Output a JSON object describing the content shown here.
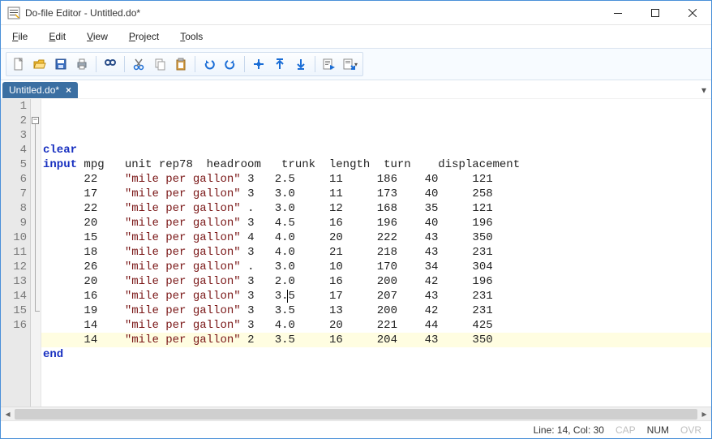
{
  "window": {
    "title": "Do-file Editor - Untitled.do*"
  },
  "menubar": {
    "file": {
      "ul": "F",
      "rest": "ile"
    },
    "edit": {
      "ul": "E",
      "rest": "dit"
    },
    "view": {
      "ul": "V",
      "rest": "iew"
    },
    "project": {
      "ul": "P",
      "rest": "roject"
    },
    "tools": {
      "ul": "T",
      "rest": "ools"
    }
  },
  "tab": {
    "label": "Untitled.do*",
    "close": "×"
  },
  "code": {
    "kw_clear": "clear",
    "kw_input": "input",
    "kw_end": "end",
    "header_vars": " mpg   unit rep78  headroom   trunk  length  turn    displacement",
    "rows": [
      {
        "mpg": "22",
        "unit": "\"mile per gallon\"",
        "rep78": "3",
        "headroom": "2.5",
        "trunk": "11",
        "length": "186",
        "turn": "40",
        "disp": "121"
      },
      {
        "mpg": "17",
        "unit": "\"mile per gallon\"",
        "rep78": "3",
        "headroom": "3.0",
        "trunk": "11",
        "length": "173",
        "turn": "40",
        "disp": "258"
      },
      {
        "mpg": "22",
        "unit": "\"mile per gallon\"",
        "rep78": ".",
        "headroom": "3.0",
        "trunk": "12",
        "length": "168",
        "turn": "35",
        "disp": "121"
      },
      {
        "mpg": "20",
        "unit": "\"mile per gallon\"",
        "rep78": "3",
        "headroom": "4.5",
        "trunk": "16",
        "length": "196",
        "turn": "40",
        "disp": "196"
      },
      {
        "mpg": "15",
        "unit": "\"mile per gallon\"",
        "rep78": "4",
        "headroom": "4.0",
        "trunk": "20",
        "length": "222",
        "turn": "43",
        "disp": "350"
      },
      {
        "mpg": "18",
        "unit": "\"mile per gallon\"",
        "rep78": "3",
        "headroom": "4.0",
        "trunk": "21",
        "length": "218",
        "turn": "43",
        "disp": "231"
      },
      {
        "mpg": "26",
        "unit": "\"mile per gallon\"",
        "rep78": ".",
        "headroom": "3.0",
        "trunk": "10",
        "length": "170",
        "turn": "34",
        "disp": "304"
      },
      {
        "mpg": "20",
        "unit": "\"mile per gallon\"",
        "rep78": "3",
        "headroom": "2.0",
        "trunk": "16",
        "length": "200",
        "turn": "42",
        "disp": "196"
      },
      {
        "mpg": "16",
        "unit": "\"mile per gallon\"",
        "rep78": "3",
        "headroom": "3.5",
        "trunk": "17",
        "length": "207",
        "turn": "43",
        "disp": "231"
      },
      {
        "mpg": "19",
        "unit": "\"mile per gallon\"",
        "rep78": "3",
        "headroom": "3.5",
        "trunk": "13",
        "length": "200",
        "turn": "42",
        "disp": "231"
      },
      {
        "mpg": "14",
        "unit": "\"mile per gallon\"",
        "rep78": "3",
        "headroom": "4.0",
        "trunk": "20",
        "length": "221",
        "turn": "44",
        "disp": "425"
      },
      {
        "mpg": "14",
        "unit": "\"mile per gallon\"",
        "rep78": "2",
        "headroom": "3.5",
        "trunk": "16",
        "length": "204",
        "turn": "43",
        "disp": "350"
      }
    ]
  },
  "status": {
    "pos": "Line: 14, Col: 30",
    "cap": "CAP",
    "num": "NUM",
    "ovr": "OVR"
  }
}
